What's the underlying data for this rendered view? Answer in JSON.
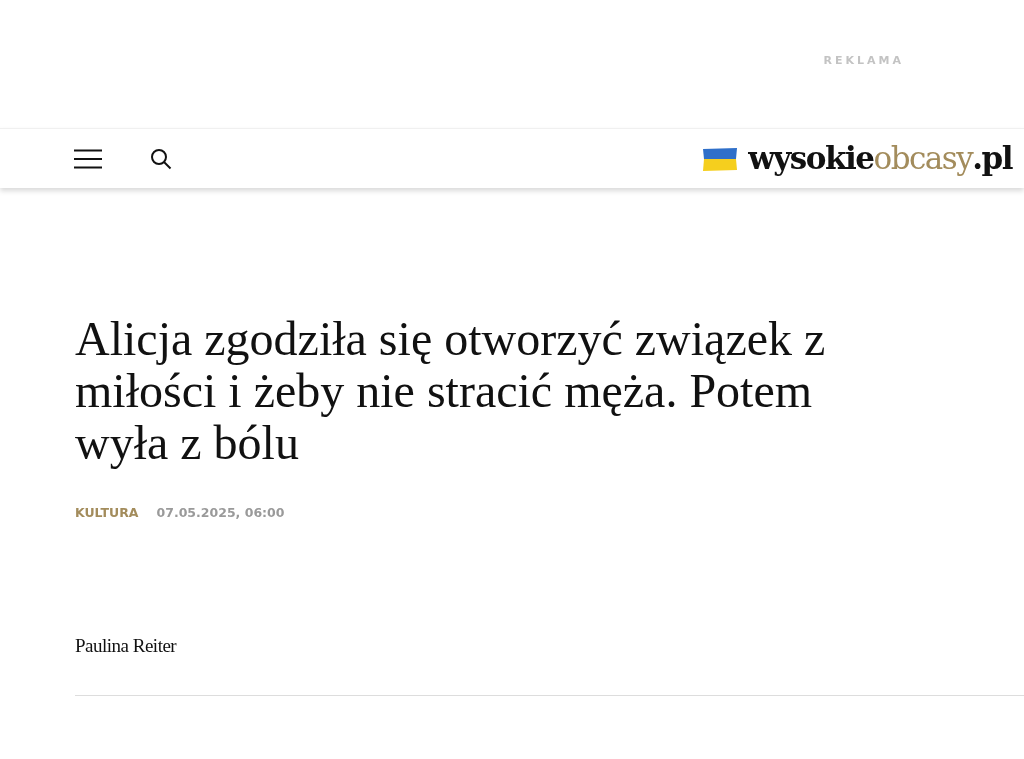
{
  "ad": {
    "label": "REKLAMA"
  },
  "header": {
    "logo": [
      {
        "text": "wysokie",
        "accent": false
      },
      {
        "text": "obcasy",
        "accent": true
      },
      {
        "text": ".pl",
        "accent": false
      }
    ]
  },
  "article": {
    "title": "Alicja zgodziła się otworzyć związek z miłości i żeby nie stracić męża. Potem wyła z bólu",
    "category": "KULTURA",
    "date": "07.05.2025, 06:00",
    "author": "Paulina Reiter"
  }
}
